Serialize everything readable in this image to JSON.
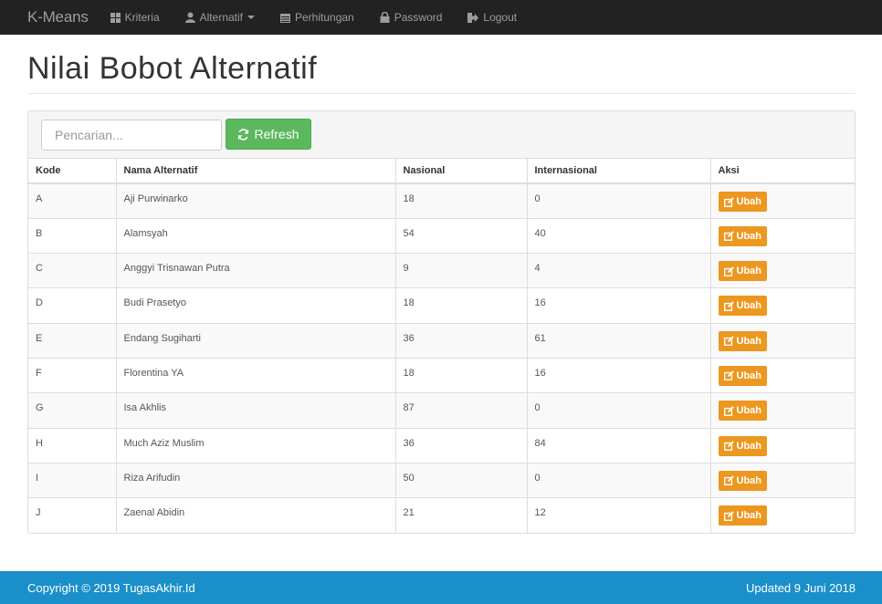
{
  "navbar": {
    "brand": "K-Means",
    "items": [
      {
        "label": "Kriteria",
        "icon": "th-large-icon"
      },
      {
        "label": "Alternatif",
        "icon": "user-icon"
      },
      {
        "label": "Perhitungan",
        "icon": "calendar-icon"
      },
      {
        "label": "Password",
        "icon": "lock-icon"
      },
      {
        "label": "Logout",
        "icon": "log-out-icon"
      }
    ]
  },
  "page": {
    "title": "Nilai Bobot Alternatif"
  },
  "toolbar": {
    "search_placeholder": "Pencarian...",
    "refresh_label": "Refresh"
  },
  "table": {
    "headers": [
      "Kode",
      "Nama Alternatif",
      "Nasional",
      "Internasional",
      "Aksi"
    ],
    "action_label": "Ubah",
    "rows": [
      {
        "kode": "A",
        "nama": "Aji Purwinarko",
        "nasional": "18",
        "internasional": "0"
      },
      {
        "kode": "B",
        "nama": "Alamsyah",
        "nasional": "54",
        "internasional": "40"
      },
      {
        "kode": "C",
        "nama": "Anggyi Trisnawan Putra",
        "nasional": "9",
        "internasional": "4"
      },
      {
        "kode": "D",
        "nama": "Budi Prasetyo",
        "nasional": "18",
        "internasional": "16"
      },
      {
        "kode": "E",
        "nama": "Endang Sugiharti",
        "nasional": "36",
        "internasional": "61"
      },
      {
        "kode": "F",
        "nama": "Florentina YA",
        "nasional": "18",
        "internasional": "16"
      },
      {
        "kode": "G",
        "nama": "Isa Akhlis",
        "nasional": "87",
        "internasional": "0"
      },
      {
        "kode": "H",
        "nama": "Much Aziz Muslim",
        "nasional": "36",
        "internasional": "84"
      },
      {
        "kode": "I",
        "nama": "Riza Arifudin",
        "nasional": "50",
        "internasional": "0"
      },
      {
        "kode": "J",
        "nama": "Zaenal Abidin",
        "nasional": "21",
        "internasional": "12"
      }
    ]
  },
  "footer": {
    "copyright": "Copyright © 2019 TugasAkhir.Id",
    "updated": "Updated 9 Juni 2018"
  },
  "colors": {
    "navbar": "#222222",
    "success": "#5cb85c",
    "warning": "#ec971f",
    "footer": "#1a8fc9"
  }
}
